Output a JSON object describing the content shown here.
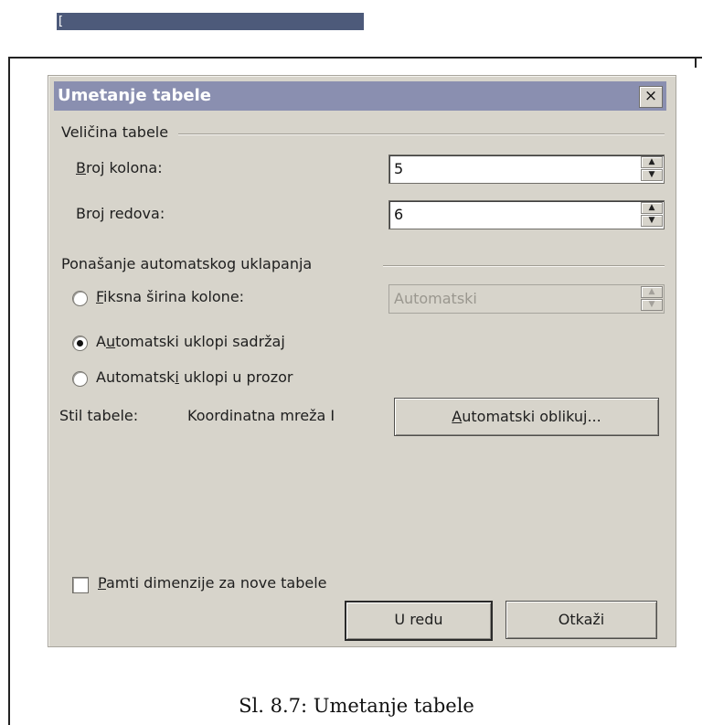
{
  "top_bar_text": "[",
  "dialog": {
    "title": "Umetanje tabele",
    "close_icon": "×",
    "size_group": {
      "label": "Veličina tabele",
      "columns_label_pre": "",
      "columns_label_u": "B",
      "columns_label_post": "roj kolona:",
      "columns_value": "5",
      "rows_label_pre": "Bro",
      "rows_label_u": "j",
      "rows_label_post": " redova:",
      "rows_value": "6"
    },
    "autofit_group": {
      "label": "Ponašanje automatskog uklapanja",
      "fixed_u": "F",
      "fixed_rest": "iksna širina kolone:",
      "fixed_value": "Automatski",
      "content_pre": "A",
      "content_u": "u",
      "content_rest": "tomatski uklopi sadržaj",
      "window_pre": "Automatsk",
      "window_u": "i",
      "window_rest": " uklopi u prozor",
      "selected": "content"
    },
    "style": {
      "label": "Stil tabele:",
      "value": "Koordinatna mreža I",
      "autoformat_u": "A",
      "autoformat_rest": "utomatski oblikuj..."
    },
    "remember": {
      "u": "P",
      "rest": "amti dimenzije za nove tabele",
      "checked": false
    },
    "ok_label": "U redu",
    "cancel_label": "Otkaži"
  },
  "caption": "Sl. 8.7: Umetanje tabele"
}
